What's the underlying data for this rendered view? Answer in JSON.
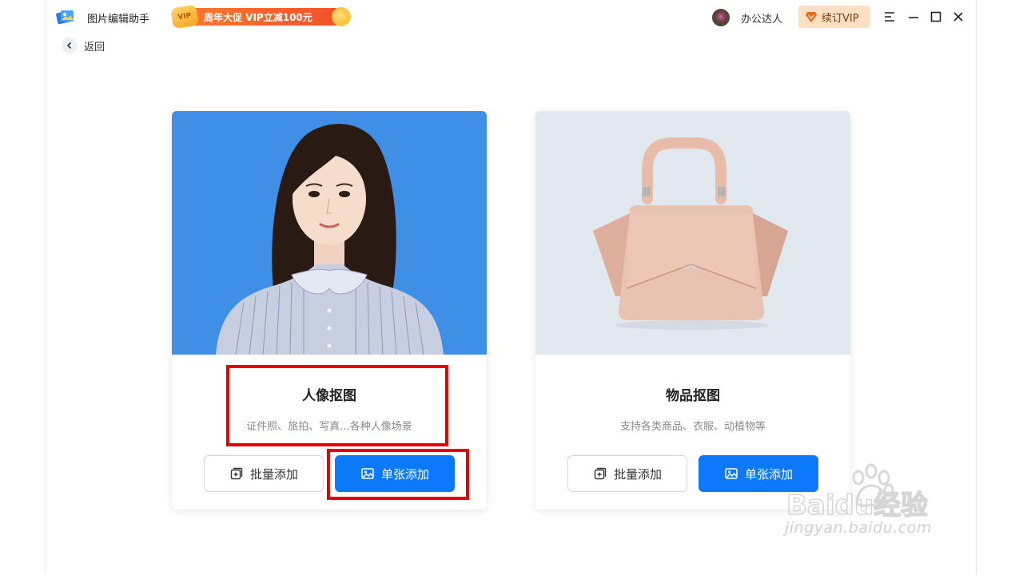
{
  "app": {
    "name": "图片编辑助手"
  },
  "promo": {
    "badge": "VIP",
    "text": "周年大促 VIP立减100元"
  },
  "user": {
    "name": "办公达人",
    "renew_label": "续订VIP"
  },
  "nav": {
    "back_label": "返回"
  },
  "cards": [
    {
      "title": "人像抠图",
      "desc": "证件照、旅拍、写真...各种人像场景",
      "batch_label": "批量添加",
      "single_label": "单张添加"
    },
    {
      "title": "物品抠图",
      "desc": "支持各类商品、衣服、动植物等",
      "batch_label": "批量添加",
      "single_label": "单张添加"
    }
  ],
  "watermark": {
    "brand": "Baidu经验",
    "url": "jingyan.baidu.com"
  },
  "colors": {
    "primary": "#0b79fa",
    "highlight": "#e80000",
    "portrait_bg": "#3f8fe6",
    "object_bg": "#e2e8f0",
    "renew_bg": "#fde0c4"
  }
}
